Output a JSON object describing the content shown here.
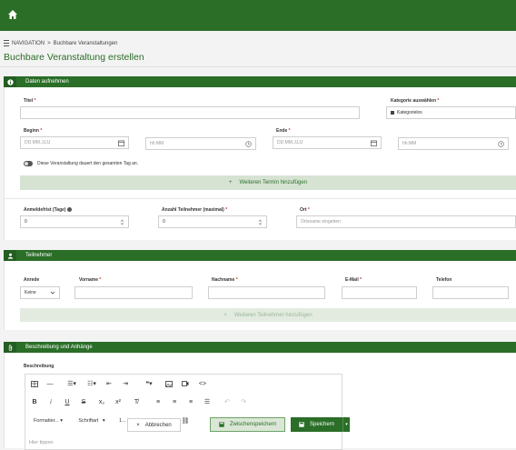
{
  "breadcrumb": {
    "nav": "NAVIGATION",
    "sep": ">",
    "current": "Buchbare Veranstaltungen"
  },
  "page": {
    "title": "Buchbare Veranstaltung erstellen"
  },
  "section_data": {
    "title": "Daten aufnehmen",
    "titel_label": "Titel",
    "kategorie_label": "Kategorie auswählen",
    "kategorie_value": "Kategorielos",
    "beginn_label": "Beginn",
    "ende_label": "Ende",
    "date_placeholder": "DD.MM.JJJJ",
    "time_placeholder": "hh:MM",
    "ganztag_label": "Diese Veranstaltung dauert den gesamten Tag an.",
    "add_termin": "Weiteren Termin hinzufügen",
    "anmeldefrist_label": "Anmeldefrist (Tage)",
    "anmeldefrist_value": "0",
    "teilnehmer_max_label": "Anzahl Teilnehmer (maximal)",
    "teilnehmer_max_value": "0",
    "ort_label": "Ort",
    "ort_placeholder": "Ortsname eingeben"
  },
  "section_participants": {
    "title": "Teilnehmer",
    "anrede_label": "Anrede",
    "anrede_value": "Keine",
    "vorname_label": "Vorname",
    "nachname_label": "Nachname",
    "email_label": "E-Mail",
    "telefon_label": "Telefon",
    "add_teilnehmer": "Weiteren Teilnehmer hinzufügen"
  },
  "section_description": {
    "title": "Beschreibung und Anhänge",
    "beschreibung_label": "Beschreibung",
    "format_label": "Formatier...",
    "font_label": "Schriftart",
    "size_label": "1...",
    "editor_placeholder": "Hier tippen"
  },
  "actions": {
    "cancel": "Abbrechen",
    "draft": "Zwischenspeichern",
    "save": "Speichern"
  },
  "required_mark": "*",
  "colors": {
    "brand_green": "#2a6e27",
    "light_green": "#d6e3d3",
    "required": "#c0392b"
  }
}
